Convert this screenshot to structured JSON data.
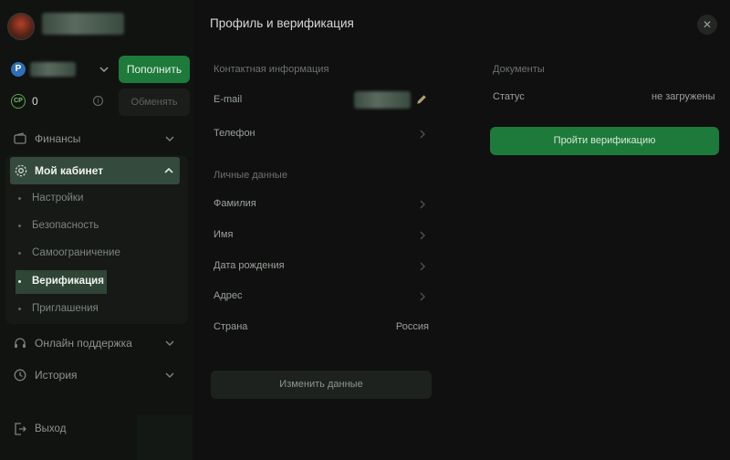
{
  "sidebar": {
    "balance": {
      "currency_badge": "P"
    },
    "topup_label": "Пополнить",
    "cp": {
      "badge": "CP",
      "value": "0",
      "info_glyph": "i"
    },
    "exchange_label": "Обменять",
    "finance_label": "Финансы",
    "cabinet_label": "Мой кабинет",
    "cabinet_items": [
      {
        "label": "Настройки"
      },
      {
        "label": "Безопасность"
      },
      {
        "label": "Самоограничение"
      },
      {
        "label": "Верификация"
      },
      {
        "label": "Приглашения"
      }
    ],
    "support_label": "Онлайн поддержка",
    "history_label": "История",
    "exit_label": "Выход"
  },
  "modal": {
    "title": "Профиль и верификация",
    "close_glyph": "✕",
    "contact_section": "Контактная информация",
    "email_label": "E-mail",
    "phone_label": "Телефон",
    "personal_section": "Личные данные",
    "surname_label": "Фамилия",
    "name_label": "Имя",
    "birthdate_label": "Дата рождения",
    "address_label": "Адрес",
    "country_label": "Страна",
    "country_value": "Россия",
    "edit_button": "Изменить данные",
    "documents_section": "Документы",
    "status_label": "Статус",
    "status_value": "не загружены",
    "verify_button": "Пройти верификацию"
  },
  "colors": {
    "accent": "#1d7a3a",
    "active_bg": "#344a3c",
    "background": "#0f100f"
  }
}
